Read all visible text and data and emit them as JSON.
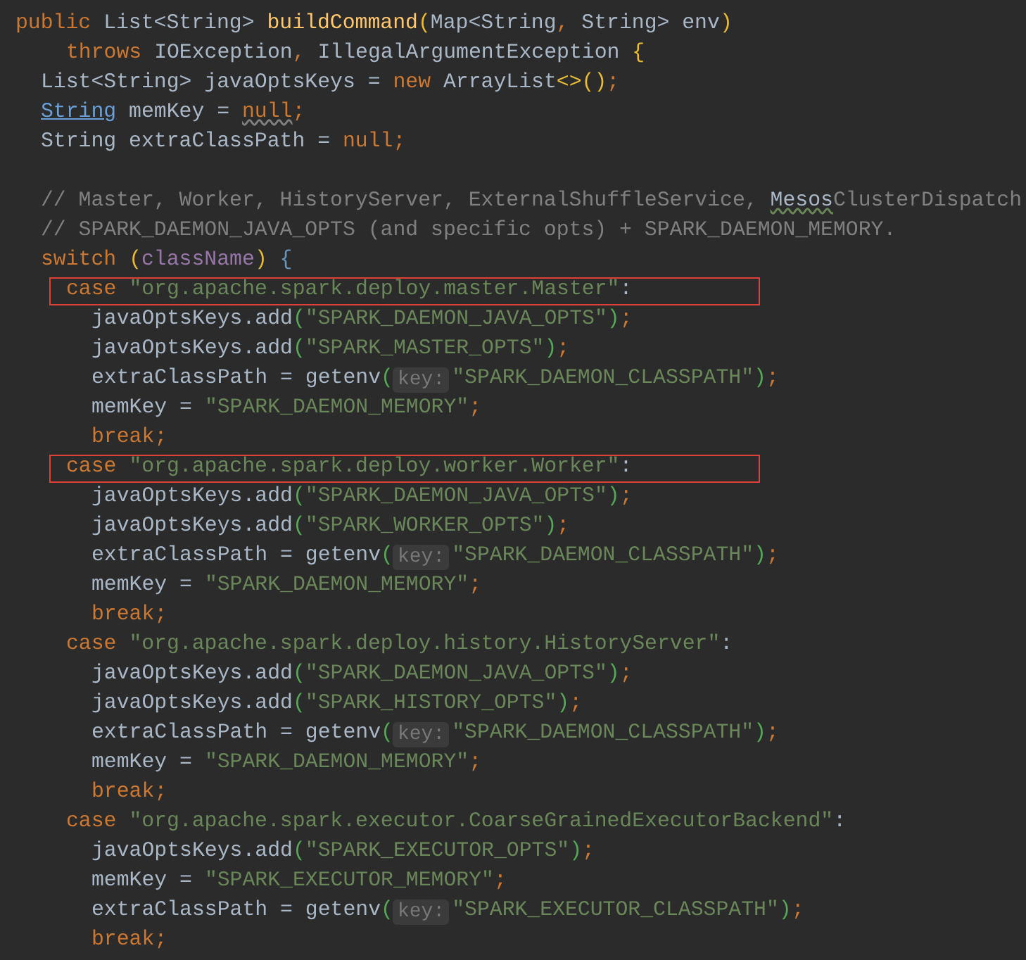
{
  "editor": {
    "lines": [
      {
        "kind": "signature",
        "boxed": false,
        "tokens": [
          {
            "kind": "kw",
            "text": "public "
          },
          {
            "kind": "plain",
            "text": "List<String> "
          },
          {
            "kind": "method",
            "text": "buildCommand"
          },
          {
            "kind": "br1",
            "text": "("
          },
          {
            "kind": "plain",
            "text": "Map<String"
          },
          {
            "kind": "punct",
            "text": ","
          },
          {
            "kind": "plain",
            "text": " String> env"
          },
          {
            "kind": "br1",
            "text": ")"
          }
        ]
      },
      {
        "kind": "throws",
        "boxed": false,
        "tokens": [
          {
            "kind": "kw",
            "text": "throws "
          },
          {
            "kind": "plain",
            "text": "IOException"
          },
          {
            "kind": "punct",
            "text": ","
          },
          {
            "kind": "plain",
            "text": " IllegalArgumentException "
          },
          {
            "kind": "br1",
            "text": "{"
          }
        ]
      },
      {
        "kind": "member",
        "boxed": false,
        "tokens": [
          {
            "kind": "plain",
            "text": "List<String> javaOptsKeys = "
          },
          {
            "kind": "kw",
            "text": "new "
          },
          {
            "kind": "plain",
            "text": "ArrayList"
          },
          {
            "kind": "br1",
            "text": "<>()"
          },
          {
            "kind": "punct",
            "text": ";"
          }
        ]
      },
      {
        "kind": "member",
        "boxed": false,
        "tokens": [
          {
            "kind": "link",
            "text": "String"
          },
          {
            "kind": "plain",
            "text": " memKey = "
          },
          {
            "kind": "warn",
            "text": "null"
          },
          {
            "kind": "punct",
            "text": ";"
          }
        ]
      },
      {
        "kind": "member",
        "boxed": false,
        "tokens": [
          {
            "kind": "plain",
            "text": "String extraClassPath = "
          },
          {
            "kind": "kw",
            "text": "null"
          },
          {
            "kind": "punct",
            "text": ";"
          }
        ]
      },
      {
        "kind": "blank",
        "boxed": false
      },
      {
        "kind": "member",
        "boxed": false,
        "tokens": [
          {
            "kind": "comment",
            "text": "// Master, Worker, HistoryServer, ExternalShuffleService, "
          },
          {
            "kind": "typo",
            "text": "Mesos"
          },
          {
            "kind": "comment",
            "text": "ClusterDispatch"
          }
        ]
      },
      {
        "kind": "member",
        "boxed": false,
        "tokens": [
          {
            "kind": "comment",
            "text": "// SPARK_DAEMON_JAVA_OPTS (and specific opts) + SPARK_DAEMON_MEMORY."
          }
        ]
      },
      {
        "kind": "member",
        "boxed": false,
        "tokens": [
          {
            "kind": "kw",
            "text": "switch "
          },
          {
            "kind": "br1",
            "text": "("
          },
          {
            "kind": "field",
            "text": "className"
          },
          {
            "kind": "br1",
            "text": ")"
          },
          {
            "kind": "br3",
            "text": " {"
          }
        ]
      },
      {
        "kind": "case",
        "boxed": true,
        "tokens": [
          {
            "kind": "kw",
            "text": "case "
          },
          {
            "kind": "str",
            "text": "\"org.apache.spark.deploy.master.Master\""
          },
          {
            "kind": "plain",
            "text": ":"
          }
        ]
      },
      {
        "kind": "stmt",
        "boxed": false,
        "tokens": [
          {
            "kind": "plain",
            "text": "javaOptsKeys.add"
          },
          {
            "kind": "br2",
            "text": "("
          },
          {
            "kind": "str",
            "text": "\"SPARK_DAEMON_JAVA_OPTS\""
          },
          {
            "kind": "br2",
            "text": ")"
          },
          {
            "kind": "punct",
            "text": ";"
          }
        ]
      },
      {
        "kind": "stmt",
        "boxed": false,
        "tokens": [
          {
            "kind": "plain",
            "text": "javaOptsKeys.add"
          },
          {
            "kind": "br2",
            "text": "("
          },
          {
            "kind": "str",
            "text": "\"SPARK_MASTER_OPTS\""
          },
          {
            "kind": "br2",
            "text": ")"
          },
          {
            "kind": "punct",
            "text": ";"
          }
        ]
      },
      {
        "kind": "stmt",
        "boxed": false,
        "tokens": [
          {
            "kind": "plain",
            "text": "extraClassPath = getenv"
          },
          {
            "kind": "br2",
            "text": "("
          },
          {
            "kind": "hint",
            "text": "key:"
          },
          {
            "kind": "str",
            "text": "\"SPARK_DAEMON_CLASSPATH\""
          },
          {
            "kind": "br2",
            "text": ")"
          },
          {
            "kind": "punct",
            "text": ";"
          }
        ]
      },
      {
        "kind": "stmt",
        "boxed": false,
        "tokens": [
          {
            "kind": "plain",
            "text": "memKey = "
          },
          {
            "kind": "str",
            "text": "\"SPARK_DAEMON_MEMORY\""
          },
          {
            "kind": "punct",
            "text": ";"
          }
        ]
      },
      {
        "kind": "stmt",
        "boxed": false,
        "tokens": [
          {
            "kind": "kw",
            "text": "break"
          },
          {
            "kind": "punct",
            "text": ";"
          }
        ]
      },
      {
        "kind": "case",
        "boxed": true,
        "tokens": [
          {
            "kind": "kw",
            "text": "case "
          },
          {
            "kind": "str",
            "text": "\"org.apache.spark.deploy.worker.Worker\""
          },
          {
            "kind": "plain",
            "text": ":"
          }
        ]
      },
      {
        "kind": "stmt",
        "boxed": false,
        "tokens": [
          {
            "kind": "plain",
            "text": "javaOptsKeys.add"
          },
          {
            "kind": "br2",
            "text": "("
          },
          {
            "kind": "str",
            "text": "\"SPARK_DAEMON_JAVA_OPTS\""
          },
          {
            "kind": "br2",
            "text": ")"
          },
          {
            "kind": "punct",
            "text": ";"
          }
        ]
      },
      {
        "kind": "stmt",
        "boxed": false,
        "tokens": [
          {
            "kind": "plain",
            "text": "javaOptsKeys.add"
          },
          {
            "kind": "br2",
            "text": "("
          },
          {
            "kind": "str",
            "text": "\"SPARK_WORKER_OPTS\""
          },
          {
            "kind": "br2",
            "text": ")"
          },
          {
            "kind": "punct",
            "text": ";"
          }
        ]
      },
      {
        "kind": "stmt",
        "boxed": false,
        "tokens": [
          {
            "kind": "plain",
            "text": "extraClassPath = getenv"
          },
          {
            "kind": "br2",
            "text": "("
          },
          {
            "kind": "hint",
            "text": "key:"
          },
          {
            "kind": "str",
            "text": "\"SPARK_DAEMON_CLASSPATH\""
          },
          {
            "kind": "br2",
            "text": ")"
          },
          {
            "kind": "punct",
            "text": ";"
          }
        ]
      },
      {
        "kind": "stmt",
        "boxed": false,
        "tokens": [
          {
            "kind": "plain",
            "text": "memKey = "
          },
          {
            "kind": "str",
            "text": "\"SPARK_DAEMON_MEMORY\""
          },
          {
            "kind": "punct",
            "text": ";"
          }
        ]
      },
      {
        "kind": "stmt",
        "boxed": false,
        "tokens": [
          {
            "kind": "kw",
            "text": "break"
          },
          {
            "kind": "punct",
            "text": ";"
          }
        ]
      },
      {
        "kind": "case",
        "boxed": false,
        "tokens": [
          {
            "kind": "kw",
            "text": "case "
          },
          {
            "kind": "str",
            "text": "\"org.apache.spark.deploy.history.HistoryServer\""
          },
          {
            "kind": "plain",
            "text": ":"
          }
        ]
      },
      {
        "kind": "stmt",
        "boxed": false,
        "tokens": [
          {
            "kind": "plain",
            "text": "javaOptsKeys.add"
          },
          {
            "kind": "br2",
            "text": "("
          },
          {
            "kind": "str",
            "text": "\"SPARK_DAEMON_JAVA_OPTS\""
          },
          {
            "kind": "br2",
            "text": ")"
          },
          {
            "kind": "punct",
            "text": ";"
          }
        ]
      },
      {
        "kind": "stmt",
        "boxed": false,
        "tokens": [
          {
            "kind": "plain",
            "text": "javaOptsKeys.add"
          },
          {
            "kind": "br2",
            "text": "("
          },
          {
            "kind": "str",
            "text": "\"SPARK_HISTORY_OPTS\""
          },
          {
            "kind": "br2",
            "text": ")"
          },
          {
            "kind": "punct",
            "text": ";"
          }
        ]
      },
      {
        "kind": "stmt",
        "boxed": false,
        "tokens": [
          {
            "kind": "plain",
            "text": "extraClassPath = getenv"
          },
          {
            "kind": "br2",
            "text": "("
          },
          {
            "kind": "hint",
            "text": "key:"
          },
          {
            "kind": "str",
            "text": "\"SPARK_DAEMON_CLASSPATH\""
          },
          {
            "kind": "br2",
            "text": ")"
          },
          {
            "kind": "punct",
            "text": ";"
          }
        ]
      },
      {
        "kind": "stmt",
        "boxed": false,
        "tokens": [
          {
            "kind": "plain",
            "text": "memKey = "
          },
          {
            "kind": "str",
            "text": "\"SPARK_DAEMON_MEMORY\""
          },
          {
            "kind": "punct",
            "text": ";"
          }
        ]
      },
      {
        "kind": "stmt",
        "boxed": false,
        "tokens": [
          {
            "kind": "kw",
            "text": "break"
          },
          {
            "kind": "punct",
            "text": ";"
          }
        ]
      },
      {
        "kind": "case",
        "boxed": false,
        "tokens": [
          {
            "kind": "kw",
            "text": "case "
          },
          {
            "kind": "str",
            "text": "\"org.apache.spark.executor.CoarseGrainedExecutorBackend\""
          },
          {
            "kind": "plain",
            "text": ":"
          }
        ]
      },
      {
        "kind": "stmt",
        "boxed": false,
        "tokens": [
          {
            "kind": "plain",
            "text": "javaOptsKeys.add"
          },
          {
            "kind": "br2",
            "text": "("
          },
          {
            "kind": "str",
            "text": "\"SPARK_EXECUTOR_OPTS\""
          },
          {
            "kind": "br2",
            "text": ")"
          },
          {
            "kind": "punct",
            "text": ";"
          }
        ]
      },
      {
        "kind": "stmt",
        "boxed": false,
        "tokens": [
          {
            "kind": "plain",
            "text": "memKey = "
          },
          {
            "kind": "str",
            "text": "\"SPARK_EXECUTOR_MEMORY\""
          },
          {
            "kind": "punct",
            "text": ";"
          }
        ]
      },
      {
        "kind": "stmt",
        "boxed": false,
        "tokens": [
          {
            "kind": "plain",
            "text": "extraClassPath = getenv"
          },
          {
            "kind": "br2",
            "text": "("
          },
          {
            "kind": "hint",
            "text": "key:"
          },
          {
            "kind": "str",
            "text": "\"SPARK_EXECUTOR_CLASSPATH\""
          },
          {
            "kind": "br2",
            "text": ")"
          },
          {
            "kind": "punct",
            "text": ";"
          }
        ]
      },
      {
        "kind": "stmt",
        "boxed": false,
        "tokens": [
          {
            "kind": "kw",
            "text": "break"
          },
          {
            "kind": "punct",
            "text": ";"
          }
        ]
      }
    ]
  }
}
